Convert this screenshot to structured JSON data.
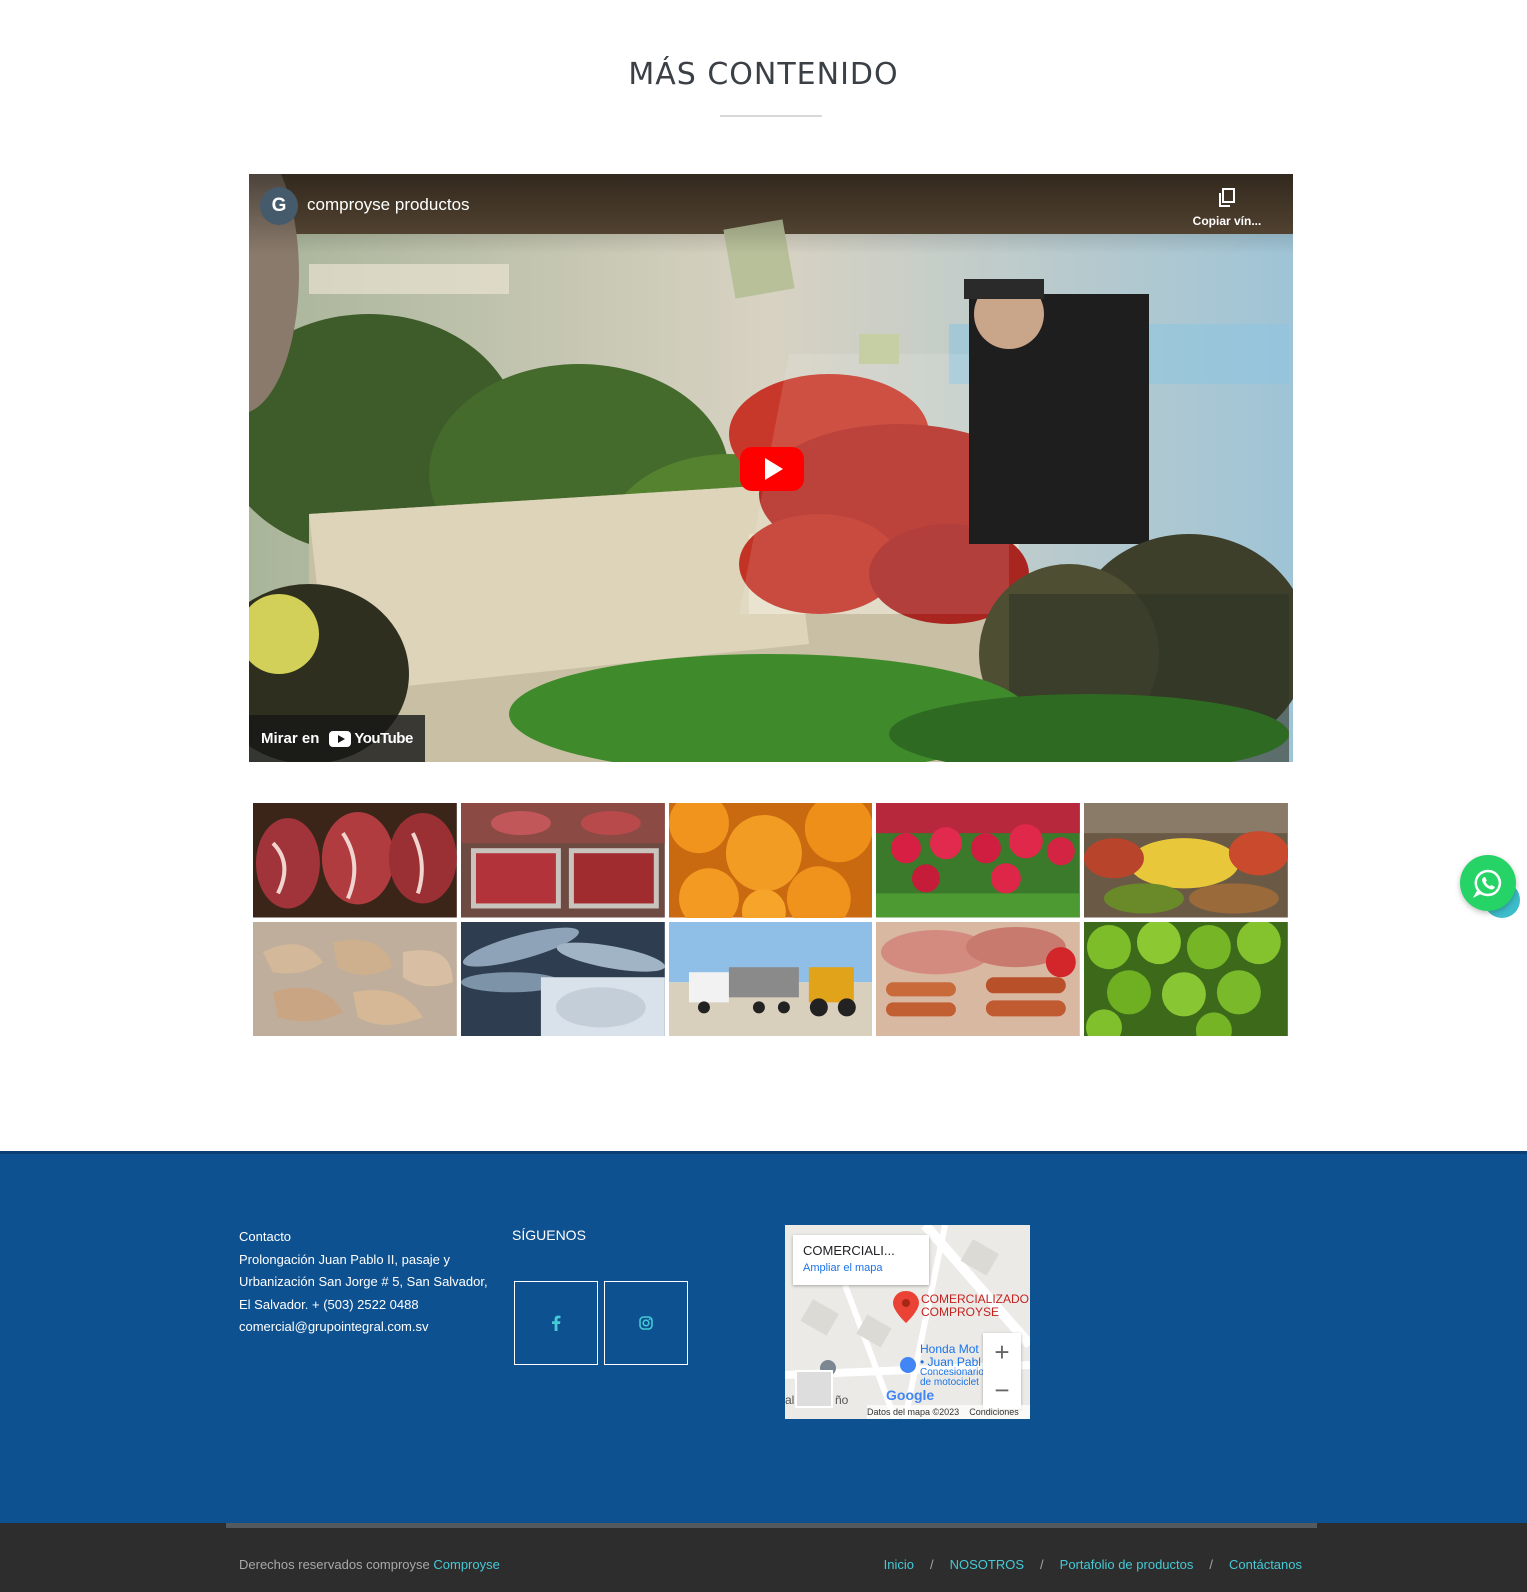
{
  "section": {
    "title": "MÁS CONTENIDO"
  },
  "video": {
    "channel_initial": "G",
    "channel_name": "comproyse productos",
    "copy_link_label": "Copiar vín...",
    "watch_on_label": "Mirar en",
    "youtube_label": "YouTube"
  },
  "gallery": [
    {
      "name": "beef-steaks"
    },
    {
      "name": "meat-trays"
    },
    {
      "name": "oranges"
    },
    {
      "name": "radishes"
    },
    {
      "name": "market-fruits"
    },
    {
      "name": "shrimp"
    },
    {
      "name": "fish"
    },
    {
      "name": "trucks-loader"
    },
    {
      "name": "deli-meats"
    },
    {
      "name": "limes"
    }
  ],
  "footer": {
    "contact": {
      "heading": "Contacto",
      "line1": "Prolongación Juan Pablo II, pasaje y",
      "line2": "Urbanización San Jorge # 5, San Salvador,",
      "line3": "El Salvador. + (503) 2522 0488",
      "email": "comercial@grupointegral.com.sv"
    },
    "social": {
      "title": "SÍGUENOS",
      "facebook_icon": "facebook-icon",
      "instagram_icon": "instagram-icon"
    },
    "map": {
      "card_title": "COMERCIALI...",
      "card_link": "Ampliar el mapa",
      "pin_label_1": "COMERCIALIZADO",
      "pin_label_2": "COMPROYSE",
      "poi_label_1": "Honda Mot",
      "poi_label_2": "• Juan Pabl",
      "poi_sub_1": "Concesionario",
      "poi_sub_2": "de motociclet",
      "google": "Google",
      "attribution": "Datos del mapa ©2023",
      "terms": "Condiciones",
      "zoom_in": "+",
      "zoom_out": "−",
      "edge_text_1": "al",
      "edge_text_2": "ño"
    },
    "bottom": {
      "copyright": "Derechos reservados comproyse",
      "brand": "Comproyse",
      "nav": [
        "Inicio",
        "NOSOTROS",
        "Portafolio de productos",
        "Contáctanos"
      ],
      "separator": "/"
    }
  },
  "colors": {
    "footer_bg": "#0e5190",
    "bottom_bg": "#2d2d2d",
    "accent": "#44c9d6",
    "whatsapp": "#25d366",
    "play_red": "#ff0000"
  }
}
